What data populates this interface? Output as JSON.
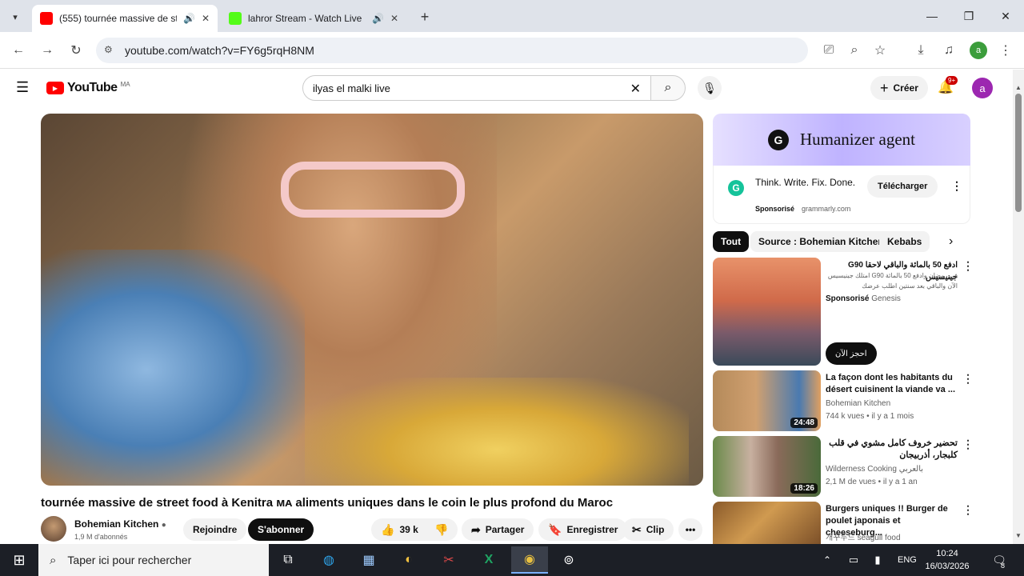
{
  "browser": {
    "tabs": [
      {
        "title": "(555) tournée massive de st",
        "active": true
      },
      {
        "title": "lahror Stream - Watch Live",
        "active": false
      }
    ],
    "url": "youtube.com/watch?v=FY6g5rqH8NM",
    "profile_initial": "a"
  },
  "youtube": {
    "logo_text": "YouTube",
    "region": "MA",
    "search_value": "ilyas el malki live",
    "create_label": "Créer",
    "notifications_badge": "9+",
    "avatar_initial": "a"
  },
  "video": {
    "title": "tournée massive de street food à Kenitra ᴍᴀ aliments uniques dans le coin le plus profond du Maroc",
    "channel": "Bohemian Kitchen",
    "subscribers": "1,9 M d'abonnés",
    "join_label": "Rejoindre",
    "subscribe_label": "S'abonner",
    "likes": "39 k",
    "share_label": "Partager",
    "save_label": "Enregistrer",
    "clip_label": "Clip"
  },
  "ad": {
    "banner_text": "Humanizer agent",
    "headline": "Think. Write. Fix. Done.",
    "sponsored": "Sponsorisé",
    "domain": "grammarly.com",
    "cta": "Télécharger"
  },
  "chips": [
    "Tout",
    "Source : Bohemian Kitchen",
    "Kebabs"
  ],
  "recommendations": [
    {
      "title": "ادفع 50 بالمائة والباقي لاحقا G90 جينيسيس",
      "line2": "في رمضان وادفع 50 بالمائة G90 امتلك جينيسيس",
      "line3": "الآن والباقي بعد سنتين اطلب عرضك",
      "sponsored": "Sponsorisé",
      "advertiser": "Genesis",
      "cta": "احجز الآن"
    },
    {
      "title": "La façon dont les habitants du désert cuisinent la viande va ...",
      "channel": "Bohemian Kitchen",
      "meta": "744 k vues • il y a 1 mois",
      "duration": "24:48"
    },
    {
      "title": "تحضير خروف كامل مشوي في قلب كلبجار، أذربيجان",
      "channel": "Wilderness Cooking بالعربي",
      "meta": "2,1 M de vues • il y a 1 an",
      "duration": "18:26"
    },
    {
      "title": "Burgers uniques !! Burger de poulet japonais et cheeseburg...",
      "channel": "개꾸두드 seagull food",
      "meta": ""
    }
  ],
  "taskbar": {
    "search_placeholder": "Taper ici pour rechercher",
    "language": "ENG",
    "time": "10:24",
    "date": "16/03/2026",
    "notif_count": "8"
  },
  "colors": {
    "youtube_red": "#ff0000",
    "subscribe_bg": "#0f0f0f",
    "avatar_purple": "#9c27b0",
    "taskbar_bg": "#1c1f26"
  }
}
